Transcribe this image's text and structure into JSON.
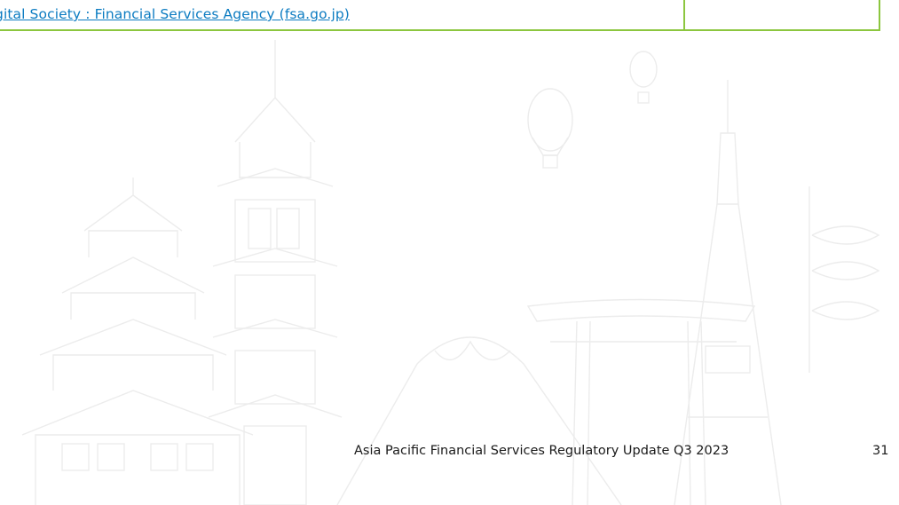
{
  "table": {
    "link_text": "gital Society : Financial Services Agency (fsa.go.jp)",
    "right_cell": ""
  },
  "footer": {
    "title": "Asia Pacific Financial Services Regulatory Update Q3 2023",
    "page_number": "31"
  },
  "colors": {
    "border": "#8cc63f",
    "link": "#0b7bc1",
    "background_art": "#ececec"
  },
  "background": {
    "theme": "Japan skyline line art (castle, pagoda, Mt. Fuji, torii gate, Tokyo Tower, hot-air balloons, koinobori)"
  }
}
